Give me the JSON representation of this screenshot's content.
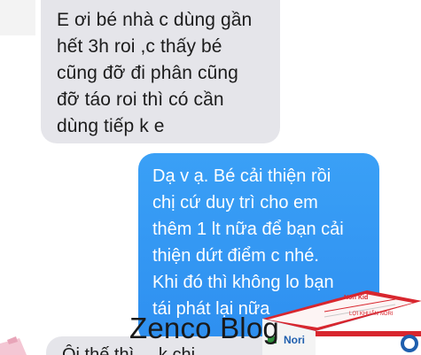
{
  "conversation": {
    "incoming_message": {
      "lines": [
        "E ơi bé nhà c dùng gần",
        "hết 3h roi ,c thấy bé",
        "cũng đỡ đi phân cũng",
        "đỡ táo roi thì có cần",
        "dùng tiếp k e"
      ]
    },
    "outgoing_message": {
      "lines": [
        "Dạ v ạ. Bé cải thiện rồi",
        "chị cứ duy trì cho em",
        "thêm 1 lt nữa để bạn cải",
        "thiện dứt điểm c nhé.",
        "Khi đó thì không lo bạn",
        "tái phát lại nữa"
      ]
    },
    "next_incoming_message": {
      "partial_text": "Ôi thế thì ... k chị"
    }
  },
  "watermark": {
    "text": "Zenco Blog"
  },
  "product": {
    "brand_text": "Nori Kid",
    "box_text_1": "LỢI KHUẨN NORI",
    "box_text_2": "Nori",
    "icon": "product-box-image",
    "colors": {
      "red": "#d8262e",
      "white": "#ffffff",
      "green": "#2f8f3a",
      "blue": "#1f5fae"
    }
  },
  "colors": {
    "incoming_bubble": "#e5e5ea",
    "outgoing_bubble": "#3197f3",
    "outgoing_text": "#ffffff",
    "incoming_text": "#1c1c1c"
  }
}
